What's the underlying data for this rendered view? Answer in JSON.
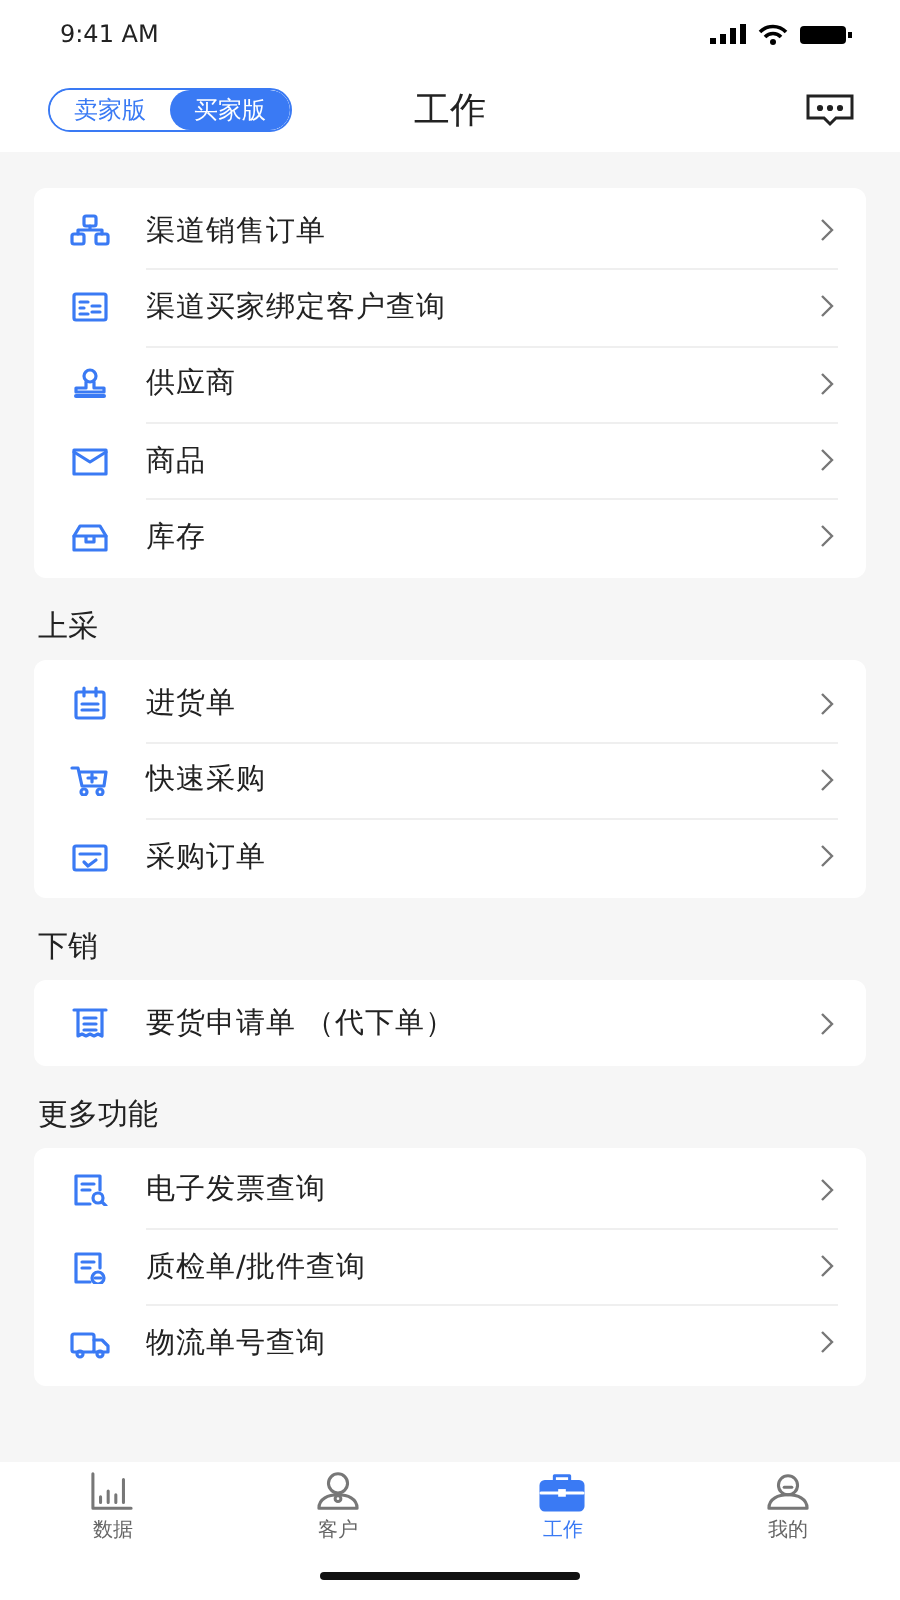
{
  "status_bar": {
    "time": "9:41 AM"
  },
  "header": {
    "title": "工作",
    "toggle": [
      {
        "label": "卖家版",
        "selected": false
      },
      {
        "label": "买家版",
        "selected": true
      }
    ]
  },
  "sections": [
    {
      "items": [
        {
          "label": "渠道销售订单"
        },
        {
          "label": "渠道买家绑定客户查询"
        },
        {
          "label": "供应商"
        },
        {
          "label": "商品"
        },
        {
          "label": "库存"
        }
      ]
    },
    {
      "title": "上采",
      "items": [
        {
          "label": "进货单"
        },
        {
          "label": "快速采购"
        },
        {
          "label": "采购订单"
        }
      ]
    },
    {
      "title": "下销",
      "items": [
        {
          "label": "要货申请单 （代下单）"
        }
      ]
    },
    {
      "title": "更多功能",
      "items": [
        {
          "label": "电子发票查询"
        },
        {
          "label": "质检单/批件查询"
        },
        {
          "label": "物流单号查询"
        }
      ]
    }
  ],
  "tab_bar": [
    {
      "label": "数据",
      "selected": false
    },
    {
      "label": "客户",
      "selected": false
    },
    {
      "label": "工作",
      "selected": true
    },
    {
      "label": "我的",
      "selected": false
    }
  ]
}
